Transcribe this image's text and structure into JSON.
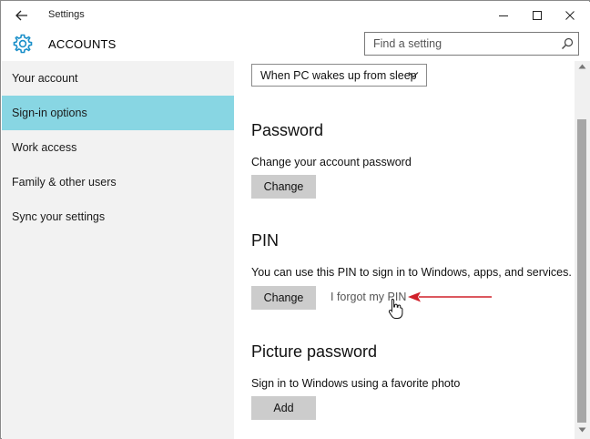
{
  "window": {
    "title": "Settings"
  },
  "header": {
    "title": "ACCOUNTS",
    "search_placeholder": "Find a setting"
  },
  "sidebar": {
    "items": [
      {
        "label": "Your account",
        "selected": false
      },
      {
        "label": "Sign-in options",
        "selected": true
      },
      {
        "label": "Work access",
        "selected": false
      },
      {
        "label": "Family & other users",
        "selected": false
      },
      {
        "label": "Sync your settings",
        "selected": false
      }
    ]
  },
  "content": {
    "require_signin_value": "When PC wakes up from sleep",
    "password": {
      "title": "Password",
      "description": "Change your account password",
      "button": "Change"
    },
    "pin": {
      "title": "PIN",
      "description": "You can use this PIN to sign in to Windows, apps, and services.",
      "button": "Change",
      "forgot_link": "I forgot my PIN"
    },
    "picture_password": {
      "title": "Picture password",
      "description": "Sign in to Windows using a favorite photo",
      "button": "Add"
    }
  },
  "colors": {
    "accent_selected": "#88d6e3",
    "sidebar_bg": "#f2f2f2",
    "button_bg": "#cccccc",
    "annotation_arrow": "#d0202a"
  },
  "icons": {
    "back": "back-arrow-icon",
    "gear": "gear-icon",
    "search": "search-icon",
    "minimize": "minimize-icon",
    "maximize": "maximize-icon",
    "close": "close-icon",
    "chevron": "chevron-down-icon",
    "pointer": "hand-pointer-icon"
  }
}
